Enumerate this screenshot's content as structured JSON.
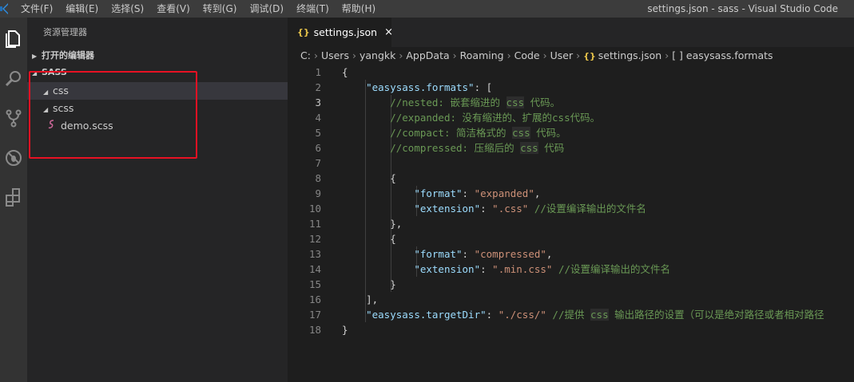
{
  "window": {
    "title": "settings.json - sass - Visual Studio Code",
    "menu": [
      "文件(F)",
      "编辑(E)",
      "选择(S)",
      "查看(V)",
      "转到(G)",
      "调试(D)",
      "终端(T)",
      "帮助(H)"
    ]
  },
  "activity_bar": [
    "files-icon",
    "search-icon",
    "source-control-icon",
    "debug-icon",
    "extensions-icon"
  ],
  "explorer": {
    "header": "资源管理器",
    "open_editors": "打开的编辑器",
    "folder": "SASS",
    "items": [
      {
        "label": "css",
        "type": "folder"
      },
      {
        "label": "scss",
        "type": "folder"
      },
      {
        "label": "demo.scss",
        "type": "file"
      }
    ]
  },
  "tab": {
    "label": "settings.json",
    "close": "×"
  },
  "breadcrumb": {
    "parts": [
      "C:",
      "Users",
      "yangkk",
      "AppData",
      "Roaming",
      "Code",
      "User"
    ],
    "file": "settings.json",
    "symbol": "[ ] easysass.formats"
  },
  "colors": {
    "highlight_border": "#e81123",
    "json_brace": "#e8c44a",
    "comment": "#6a9955",
    "key": "#9cdcfe",
    "string": "#ce9178"
  },
  "editor": {
    "current_line": 3,
    "lines": [
      {
        "n": "1",
        "tokens": [
          {
            "t": "p",
            "v": "{"
          }
        ]
      },
      {
        "n": "2",
        "tokens": [
          {
            "t": "p",
            "v": "    "
          },
          {
            "t": "k",
            "v": "\"easysass.formats\""
          },
          {
            "t": "p",
            "v": ": ["
          }
        ]
      },
      {
        "n": "3",
        "tokens": [
          {
            "t": "p",
            "v": "        "
          },
          {
            "t": "c",
            "v": "//nested: 嵌套缩进的 "
          },
          {
            "t": "cc",
            "v": "css"
          },
          {
            "t": "c",
            "v": " 代码。"
          }
        ]
      },
      {
        "n": "4",
        "tokens": [
          {
            "t": "p",
            "v": "        "
          },
          {
            "t": "c",
            "v": "//expanded: 没有缩进的、扩展的css代码。"
          }
        ]
      },
      {
        "n": "5",
        "tokens": [
          {
            "t": "p",
            "v": "        "
          },
          {
            "t": "c",
            "v": "//compact: 简洁格式的 "
          },
          {
            "t": "cc",
            "v": "css"
          },
          {
            "t": "c",
            "v": " 代码。"
          }
        ]
      },
      {
        "n": "6",
        "tokens": [
          {
            "t": "p",
            "v": "        "
          },
          {
            "t": "c",
            "v": "//compressed: 压缩后的 "
          },
          {
            "t": "cc",
            "v": "css"
          },
          {
            "t": "c",
            "v": " 代码"
          }
        ]
      },
      {
        "n": "7",
        "tokens": []
      },
      {
        "n": "8",
        "tokens": [
          {
            "t": "p",
            "v": "        {"
          }
        ]
      },
      {
        "n": "9",
        "tokens": [
          {
            "t": "p",
            "v": "            "
          },
          {
            "t": "k",
            "v": "\"format\""
          },
          {
            "t": "p",
            "v": ": "
          },
          {
            "t": "s",
            "v": "\"expanded\""
          },
          {
            "t": "p",
            "v": ","
          }
        ]
      },
      {
        "n": "10",
        "tokens": [
          {
            "t": "p",
            "v": "            "
          },
          {
            "t": "k",
            "v": "\"extension\""
          },
          {
            "t": "p",
            "v": ": "
          },
          {
            "t": "s",
            "v": "\".css\""
          },
          {
            "t": "c",
            "v": " //设置编译输出的文件名"
          }
        ]
      },
      {
        "n": "11",
        "tokens": [
          {
            "t": "p",
            "v": "        },"
          }
        ]
      },
      {
        "n": "12",
        "tokens": [
          {
            "t": "p",
            "v": "        {"
          }
        ]
      },
      {
        "n": "13",
        "tokens": [
          {
            "t": "p",
            "v": "            "
          },
          {
            "t": "k",
            "v": "\"format\""
          },
          {
            "t": "p",
            "v": ": "
          },
          {
            "t": "s",
            "v": "\"compressed\""
          },
          {
            "t": "p",
            "v": ","
          }
        ]
      },
      {
        "n": "14",
        "tokens": [
          {
            "t": "p",
            "v": "            "
          },
          {
            "t": "k",
            "v": "\"extension\""
          },
          {
            "t": "p",
            "v": ": "
          },
          {
            "t": "s",
            "v": "\".min.css\""
          },
          {
            "t": "c",
            "v": " //设置编译输出的文件名"
          }
        ]
      },
      {
        "n": "15",
        "tokens": [
          {
            "t": "p",
            "v": "        }"
          }
        ]
      },
      {
        "n": "16",
        "tokens": [
          {
            "t": "p",
            "v": "    ],"
          }
        ]
      },
      {
        "n": "17",
        "tokens": [
          {
            "t": "p",
            "v": "    "
          },
          {
            "t": "k",
            "v": "\"easysass.targetDir\""
          },
          {
            "t": "p",
            "v": ": "
          },
          {
            "t": "s",
            "v": "\"./css/\""
          },
          {
            "t": "c",
            "v": " //提供 "
          },
          {
            "t": "cc",
            "v": "css"
          },
          {
            "t": "c",
            "v": " 输出路径的设置（可以是绝对路径或者相对路径"
          }
        ]
      },
      {
        "n": "18",
        "tokens": [
          {
            "t": "p",
            "v": "}"
          }
        ]
      }
    ]
  }
}
